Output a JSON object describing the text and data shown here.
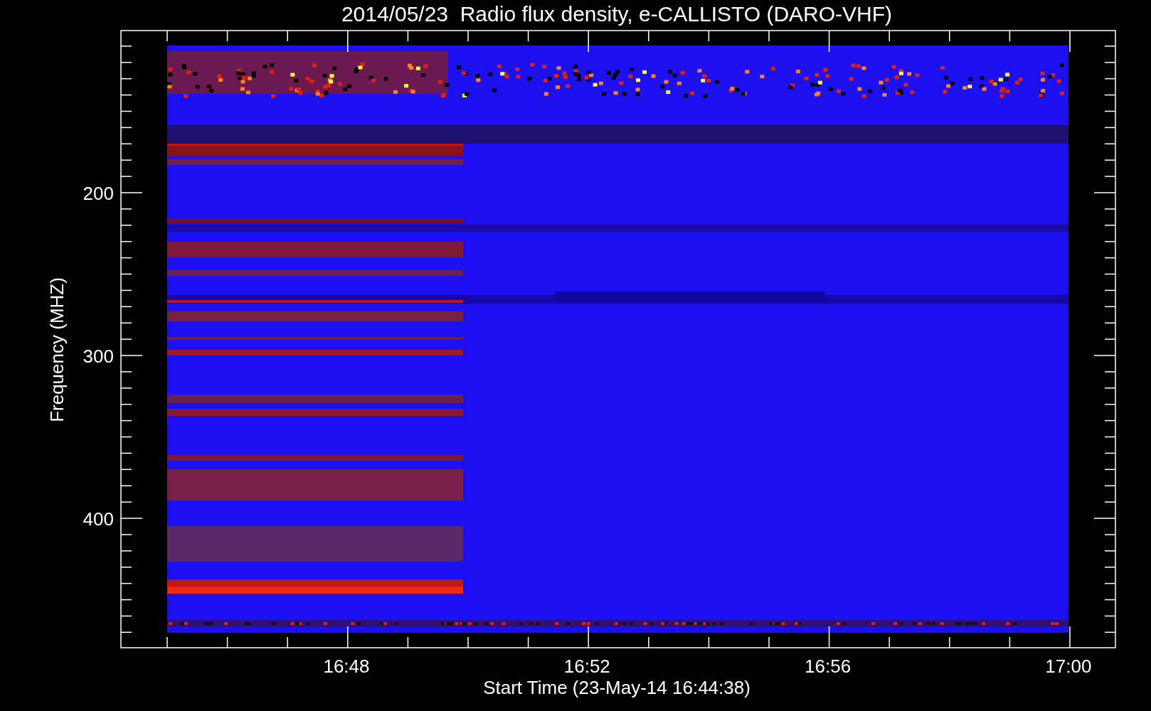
{
  "plot": {
    "title": "2014/05/23  Radio flux density, e-CALLISTO (DARO-VHF)",
    "xlabel": "Start Time (23-May-14 16:44:38)",
    "ylabel": "Frequency (MHZ)",
    "xtick_labels": [
      "16:48",
      "16:52",
      "16:56",
      "17:00"
    ],
    "ytick_labels": [
      "200",
      "300",
      "400"
    ]
  }
}
